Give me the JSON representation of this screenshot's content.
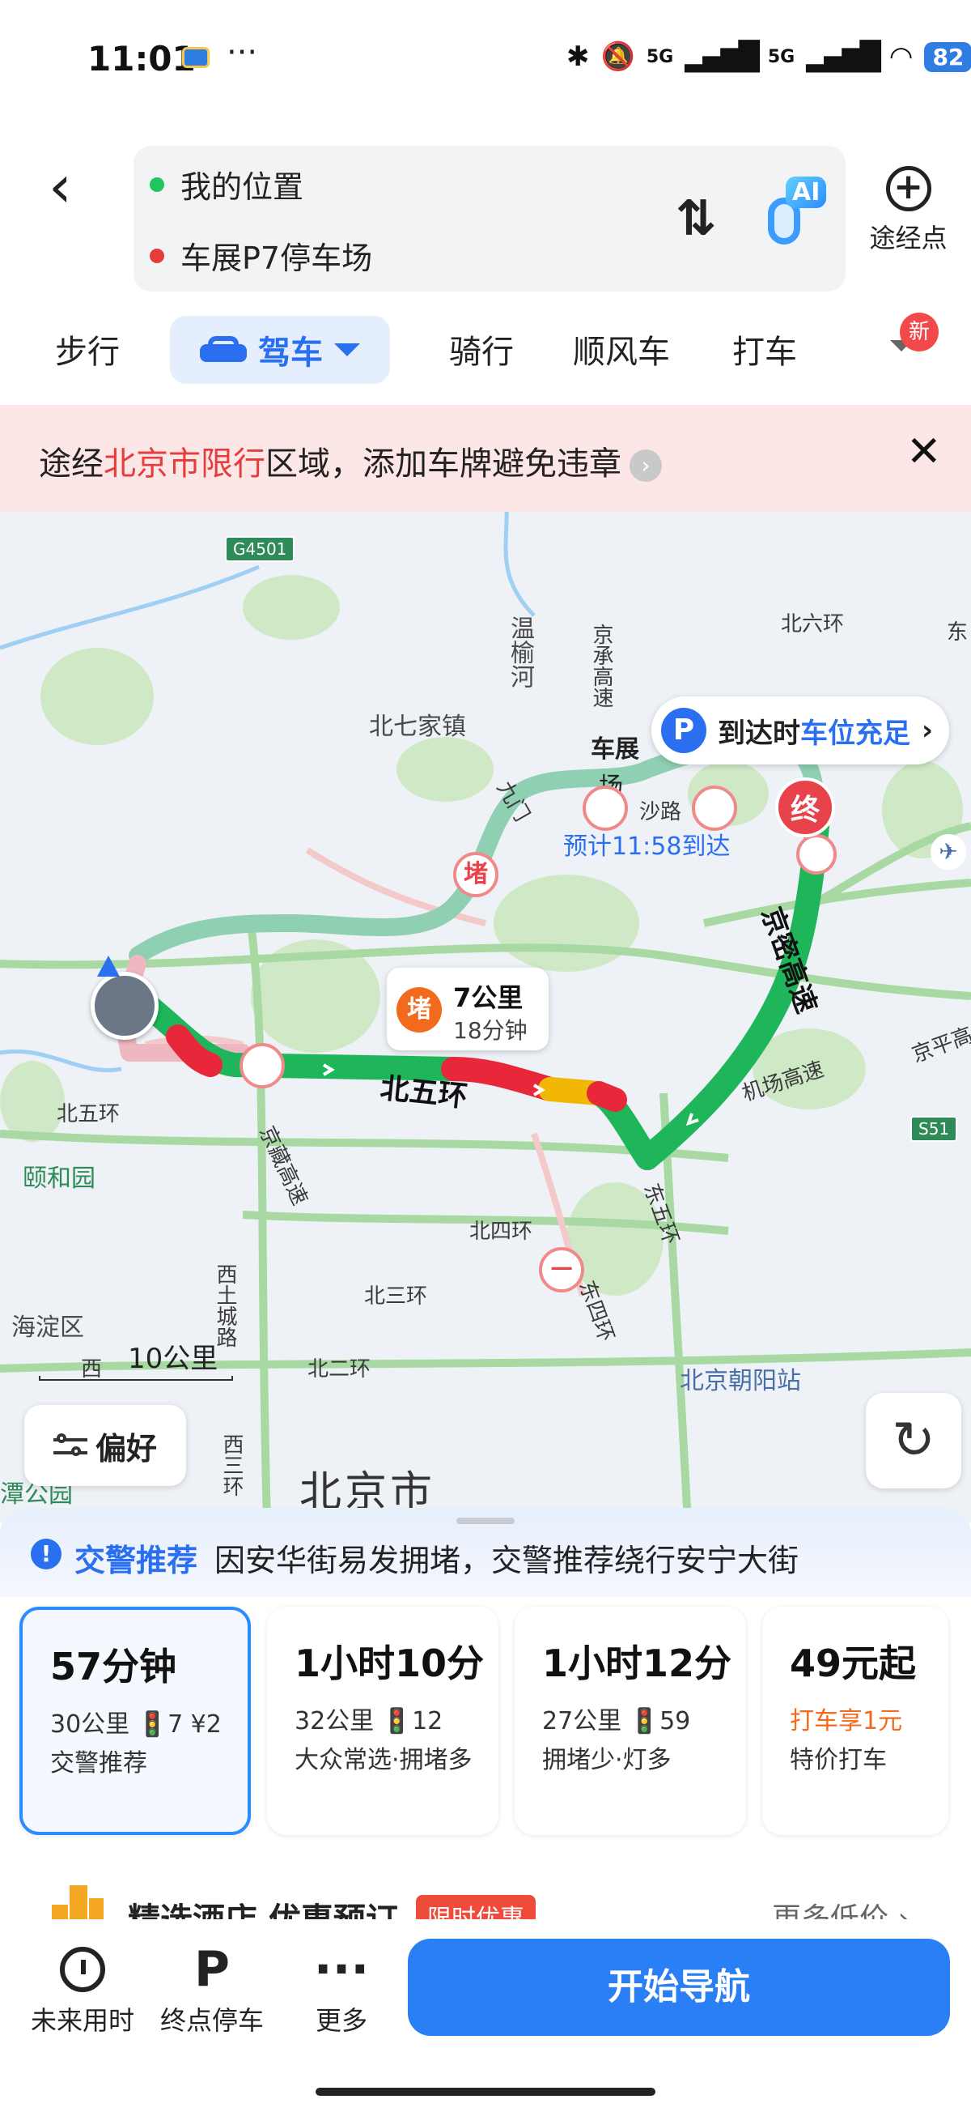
{
  "status_bar": {
    "time": "11:01",
    "more": "···",
    "network": "5G",
    "network2": "5G",
    "battery": "82"
  },
  "header": {
    "origin": "我的位置",
    "destination": "车展P7停车场",
    "ai_badge": "AI",
    "waypoint_label": "途经点",
    "origin_color": "#22c55e",
    "destination_color": "#e63c3c"
  },
  "modes": {
    "walk": "步行",
    "drive": "驾车",
    "bike": "骑行",
    "carpool": "顺风车",
    "taxi": "打车",
    "new_badge": "新"
  },
  "alert": {
    "prefix": "途经",
    "highlight": "北京市限行",
    "suffix": "区域，添加车牌避免违章",
    "close": "✕"
  },
  "map": {
    "labels": {
      "beiqijiazhen": "北七家镇",
      "wenyuhe": "温榆河",
      "jingcheng": "京承高速",
      "beiliuhuan": "北六环",
      "dong": "东",
      "chezhan": "车展",
      "chang": "场",
      "shalu": "沙路",
      "jiumen": "九门",
      "yiheyuan": "颐和园",
      "beiwuhuan_left": "北五环",
      "beiwuhuan_mid": "北五环",
      "jingzang": "京藏高速",
      "jingmi": "京密高速",
      "jichang": "机场高速",
      "jingping": "京平高",
      "dongwuhuan": "东五环",
      "beisihuan": "北四环",
      "dongsihuan": "东四环",
      "beisanhuan": "北三环",
      "beierhuan": "北二环",
      "xitucheng": "西土城路",
      "haidian": "海淀区",
      "xi": "西",
      "beijing_chaoyang": "北京朝阳站",
      "beijingshi": "北京市",
      "tan_park": "潭公园",
      "xisanhuan": "西三环",
      "shield_g4501": "G4501",
      "shield_s51": "S51"
    },
    "parking": {
      "prefix": "到达时",
      "highlight": "车位充足",
      "chevron": "›"
    },
    "eta": "预计11:58到达",
    "end_pin": "终",
    "jam_pin": "堵",
    "jam": {
      "dot": "堵",
      "distance": "7公里",
      "time": "18分钟"
    },
    "scale": "10公里",
    "preference": "偏好",
    "refresh": "↻"
  },
  "panel": {
    "tip_title": "交警推荐",
    "tip_text": "因安华街易发拥堵，交警推荐绕行安宁大街",
    "routes": [
      {
        "duration": "57分钟",
        "meta": "30公里 🚦7 ¥2",
        "tag": "交警推荐",
        "sub": "",
        "selected": true
      },
      {
        "duration": "1小时10分",
        "meta": "32公里 🚦12",
        "tag": "大众常选·拥堵多",
        "sub": "",
        "selected": false
      },
      {
        "duration": "1小时12分",
        "meta": "27公里 🚦59",
        "tag": "拥堵少·灯多",
        "sub": "",
        "selected": false
      },
      {
        "duration": "49元起",
        "meta": "",
        "tag": "打车享1元",
        "sub": "特价打车",
        "selected": false
      }
    ],
    "hotel": {
      "title": "精选酒店 优惠预订",
      "badge": "限时优惠",
      "more": "更多低价 ›"
    }
  },
  "bottom_bar": {
    "future_time": "未来用时",
    "dest_parking": "终点停车",
    "dest_parking_icon": "P",
    "more": "更多",
    "more_icon": "···",
    "start": "开始导航"
  },
  "colors": {
    "accent": "#2a6ff0",
    "route_smooth": "#1fb55a",
    "route_slow": "#f2b705",
    "route_jam": "#e8273a",
    "alert_bg": "#fde6e6"
  }
}
